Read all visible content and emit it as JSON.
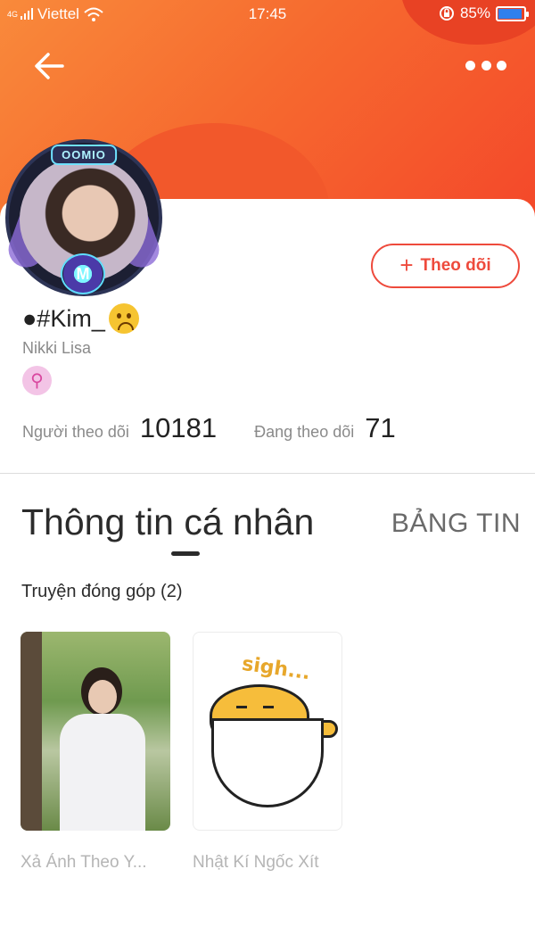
{
  "status_bar": {
    "network": "4G",
    "carrier": "Viettel",
    "time": "17:45",
    "battery": "85%",
    "battery_level": 0.85
  },
  "header": {
    "back_icon": "arrow-left-icon",
    "more_icon": "more-horizontal-icon"
  },
  "profile": {
    "avatar_frame_label": "OOMIO",
    "avatar_badge": "M",
    "display_name": "●#Kim_",
    "username": "Nikki Lisa",
    "gender_icon": "female-icon",
    "follow_button_label": "Theo dõi",
    "followers_label": "Người theo dõi",
    "followers_count": "10181",
    "following_label": "Đang theo dõi",
    "following_count": "71"
  },
  "tabs": {
    "active": "Thông tin cá nhân",
    "inactive": "BẢNG TIN"
  },
  "contributions": {
    "title": "Truyện đóng góp (2)",
    "stories": [
      {
        "title": "Xả Ảnh Theo Y..."
      },
      {
        "title": "Nhật Kí Ngốc Xít",
        "cover_text": "sigh..."
      }
    ]
  },
  "colors": {
    "header_start": "#f98a3b",
    "header_end": "#f4472a",
    "accent": "#ee4a3c"
  }
}
